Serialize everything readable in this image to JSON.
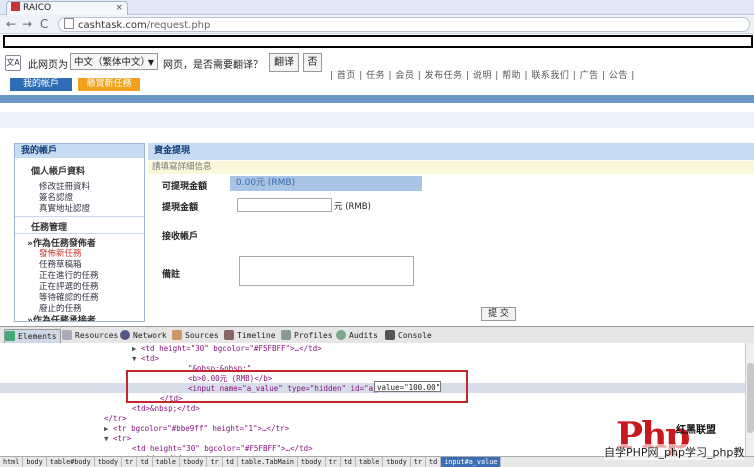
{
  "browser": {
    "tab_title": "RAICO",
    "tab_close": "×",
    "back": "←",
    "forward": "→",
    "reload": "C",
    "url_host": "cashtask.com",
    "url_path": "/request.php"
  },
  "translate_bar": {
    "icon_text": "文A",
    "prefix": "此网页为",
    "language": "中文（繁体中文）",
    "question": "网页，是否需要翻译？",
    "translate_button": "翻译",
    "no_button": "否"
  },
  "site": {
    "nav_fragment": "| 首页 | 任务 | 会员 | 发布任务 | 说明 | 帮助 | 联系我们 | 广告 | 公告 |",
    "my_account_button": "我的帐戶",
    "post_task_button": "懸賞新任務"
  },
  "sidebar": {
    "header": "我的帳戶",
    "sections": [
      {
        "title": "個人帳戶資料",
        "items": [
          {
            "label": "修改註冊資料",
            "active": false
          },
          {
            "label": "簽名認證",
            "active": false
          },
          {
            "label": "真實地址認證",
            "active": false
          }
        ]
      },
      {
        "title": "任務管理",
        "items": []
      },
      {
        "title": "»作為任務發佈者",
        "items": [
          {
            "label": "發佈新任務",
            "active": true
          },
          {
            "label": "任務草稿箱",
            "active": false
          },
          {
            "label": "正在進行的任務",
            "active": false
          },
          {
            "label": "正在評選的任務",
            "active": false
          },
          {
            "label": "等待確認的任務",
            "active": false
          },
          {
            "label": "廢止的任務",
            "active": false
          }
        ]
      },
      {
        "title": "»作為任務承接者",
        "items": []
      }
    ]
  },
  "form": {
    "title": "資金提現",
    "subtitle": "請填寫詳細信息",
    "available_label": "可提現金額",
    "available_value": "0.00元 (RMB)",
    "amount_label": "提現金額",
    "amount_unit": "元 (RMB)",
    "account_label": "接收帳戶",
    "note_label": "備註",
    "submit": "提 交"
  },
  "devtools": {
    "tabs": [
      "Elements",
      "Resources",
      "Network",
      "Sources",
      "Timeline",
      "Profiles",
      "Audits",
      "Console"
    ],
    "lines": [
      {
        "indent": 16,
        "arrow": "▶",
        "html": "<td height=\"30\" bgcolor=\"#F5FBFF\">…</td>"
      },
      {
        "indent": 16,
        "arrow": "▼",
        "html": "<td>"
      },
      {
        "indent": 24,
        "arrow": "",
        "html": "\"&nbsp;&nbsp;\""
      },
      {
        "indent": 24,
        "arrow": "",
        "html": "<b>0.00元 (RMB)</b>"
      },
      {
        "indent": 24,
        "arrow": "",
        "html": "<input name=\"a_value\" type=\"hidden\" id=\"a_value\""
      },
      {
        "indent": 20,
        "arrow": "",
        "html": "</td>"
      },
      {
        "indent": 16,
        "arrow": "",
        "html": "<td>&nbsp;</td>"
      },
      {
        "indent": 12,
        "arrow": "",
        "html": "</tr>"
      },
      {
        "indent": 12,
        "arrow": "▶",
        "html": "<tr bgcolor=\"#bbe9ff\" height=\"1\">…</tr>"
      },
      {
        "indent": 12,
        "arrow": "▼",
        "html": "<tr>"
      },
      {
        "indent": 16,
        "arrow": "",
        "html": "<td height=\"30\" bgcolor=\"#F5FBFF\">…</td>"
      },
      {
        "indent": 16,
        "arrow": "▶",
        "html": "<td>…</td>"
      }
    ],
    "value_popup": "value=\"100.00\"",
    "breadcrumbs": [
      "html",
      "body",
      "table#body",
      "tbody",
      "tr",
      "td",
      "table",
      "tbody",
      "tr",
      "td",
      "table.TabMain",
      "tbody",
      "tr",
      "td",
      "table",
      "tbody",
      "tr",
      "td",
      "input#a_value"
    ]
  },
  "watermark": {
    "logo": "Php",
    "subtitle": "红黑联盟",
    "text": "自学PHP网_php学习_php教"
  }
}
